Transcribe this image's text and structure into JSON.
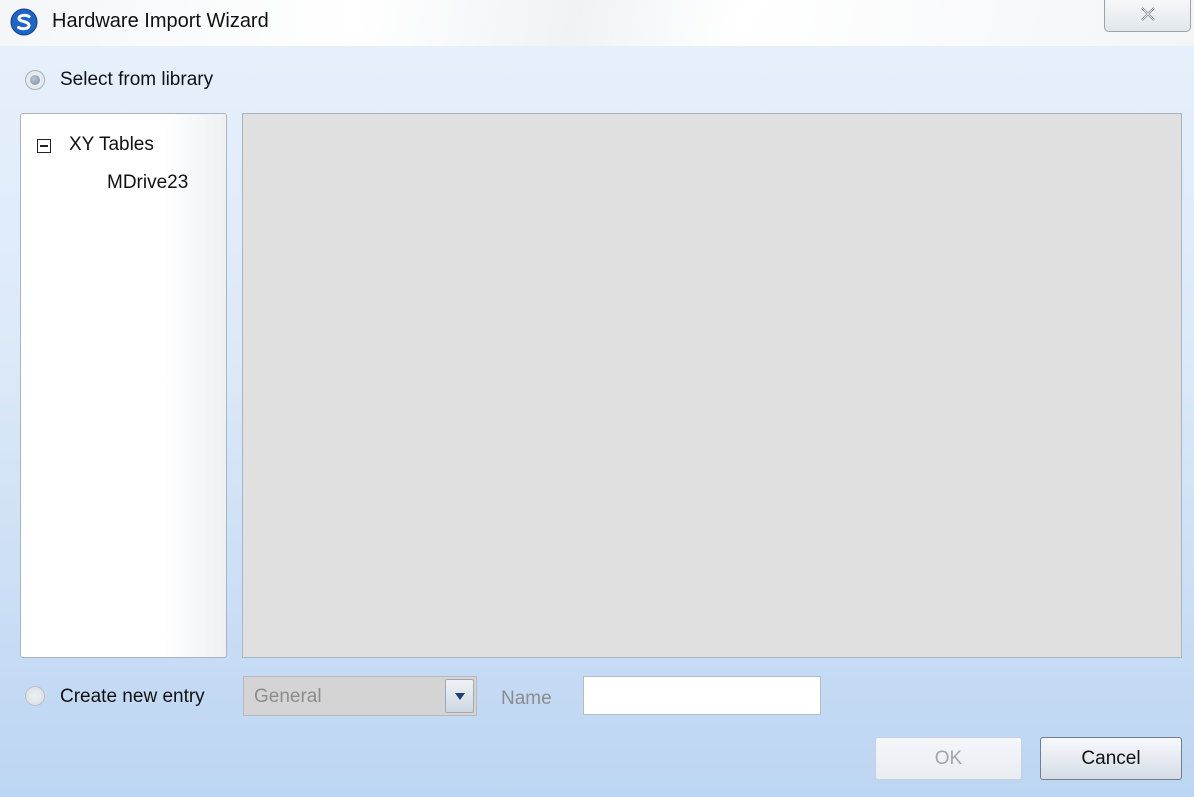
{
  "window": {
    "title": "Hardware Import Wizard",
    "close_symbol": "close-icon"
  },
  "library_option": {
    "label": "Select from library",
    "selected": true
  },
  "tree": {
    "groups": [
      {
        "label": "XY Tables",
        "expanded": true,
        "items": [
          "MDrive23"
        ]
      }
    ]
  },
  "new_entry_option": {
    "label": "Create new entry",
    "selected": false,
    "category_value": "General",
    "name_label": "Name",
    "name_value": ""
  },
  "buttons": {
    "ok": "OK",
    "cancel": "Cancel"
  },
  "colors": {
    "preview_background": "#e0e0e0",
    "window_gradient_bottom": "#bcd5f2",
    "app_icon": "#1e63c8"
  }
}
